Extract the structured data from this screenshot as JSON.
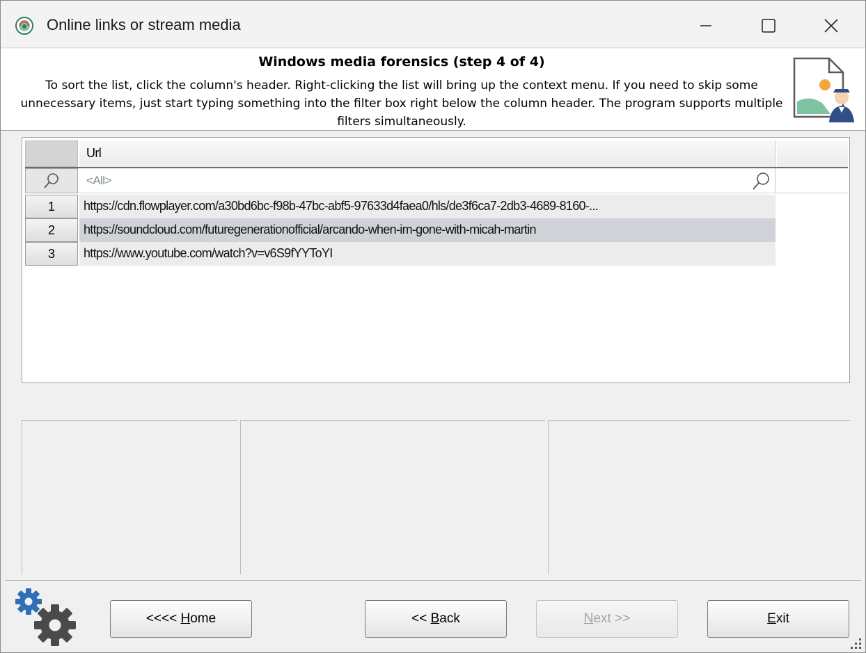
{
  "window": {
    "title": "Online links or stream media",
    "minimize_icon": "minimize-icon",
    "maximize_icon": "maximize-icon",
    "close_icon": "close-icon"
  },
  "header": {
    "title": "Windows media forensics (step 4 of 4)",
    "description": "To sort the list, click the column's header. Right-clicking the list will bring up the context menu. If you need to skip some unnecessary items, just start typing something into the filter box right below the column header. The program supports multiple filters simultaneously.",
    "icon": "media-forensics-icon"
  },
  "grid": {
    "column_header": "Url",
    "filter_placeholder": "<All>",
    "rows": [
      {
        "num": "1",
        "url": "https://cdn.flowplayer.com/a30bd6bc-f98b-47bc-abf5-97633d4faea0/hls/de3f6ca7-2db3-4689-8160-..."
      },
      {
        "num": "2",
        "url": "https://soundcloud.com/futuregenerationofficial/arcando-when-im-gone-with-micah-martin"
      },
      {
        "num": "3",
        "url": "https://www.youtube.com/watch?v=v6S9fYYToYI"
      }
    ],
    "selected_row": "2"
  },
  "buttons": {
    "home_prefix": "<<<< ",
    "home_accel": "H",
    "home_rest": "ome",
    "back_prefix": "<< ",
    "back_accel": "B",
    "back_rest": "ack",
    "next_accel": "N",
    "next_rest": "ext >>",
    "exit_accel": "E",
    "exit_rest": "xit"
  },
  "colors": {
    "selected_row": "#cfd2d6",
    "row_background": "#ececec",
    "gear_blue": "#2f6fb6",
    "gear_gray": "#4a4a4a"
  }
}
